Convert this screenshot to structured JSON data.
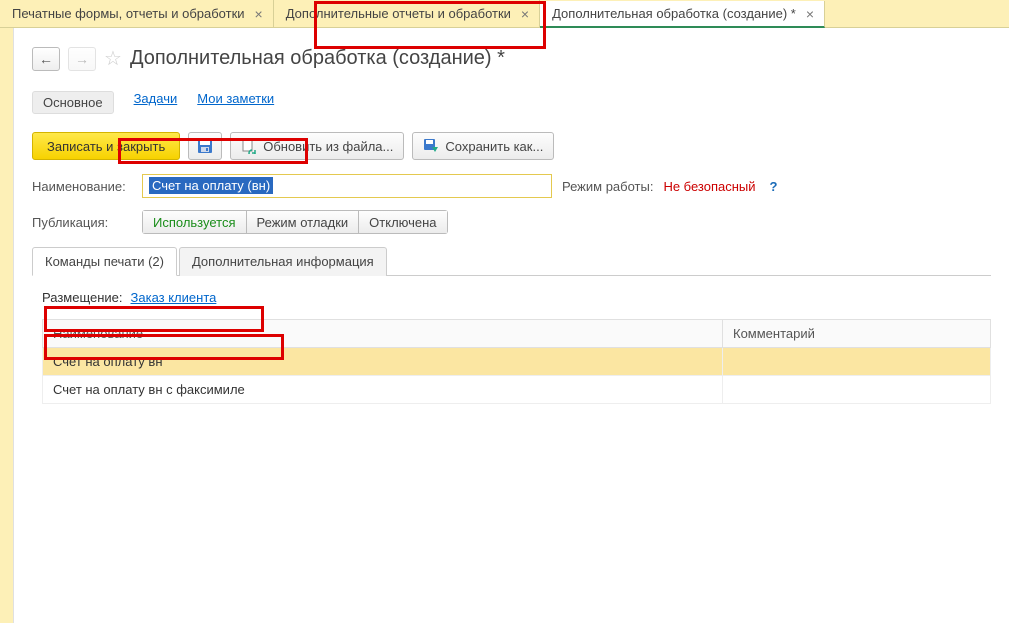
{
  "tabs": [
    {
      "label": "Печатные формы, отчеты и обработки",
      "active": false
    },
    {
      "label": "Дополнительные отчеты и обработки",
      "active": false
    },
    {
      "label": "Дополнительная обработка (создание) *",
      "active": true
    }
  ],
  "nav": {
    "back": "←",
    "forward": "→"
  },
  "title": "Дополнительная обработка (создание) *",
  "sections": {
    "main": "Основное",
    "tasks": "Задачи",
    "notes": "Мои заметки"
  },
  "toolbar": {
    "save_close": "Записать и закрыть",
    "update_file": "Обновить из файла...",
    "save_as": "Сохранить как..."
  },
  "fields": {
    "name_label": "Наименование:",
    "name_value": "Счет на оплату (вн)",
    "mode_label": "Режим работы:",
    "mode_value": "Не безопасный",
    "pub_label": "Публикация:",
    "pub_options": [
      "Используется",
      "Режим отладки",
      "Отключена"
    ]
  },
  "inner_tabs": {
    "commands": "Команды печати (2)",
    "extra": "Дополнительная информация"
  },
  "placement": {
    "label": "Размещение:",
    "link": "Заказ клиента"
  },
  "table": {
    "headers": [
      "Наименование",
      "Комментарий"
    ],
    "rows": [
      {
        "name": "Счет на оплату вн",
        "comment": "",
        "selected": true
      },
      {
        "name": "Счет на оплату вн с факсимиле",
        "comment": "",
        "selected": false
      }
    ]
  },
  "glyphs": {
    "close": "×",
    "help": "?"
  }
}
